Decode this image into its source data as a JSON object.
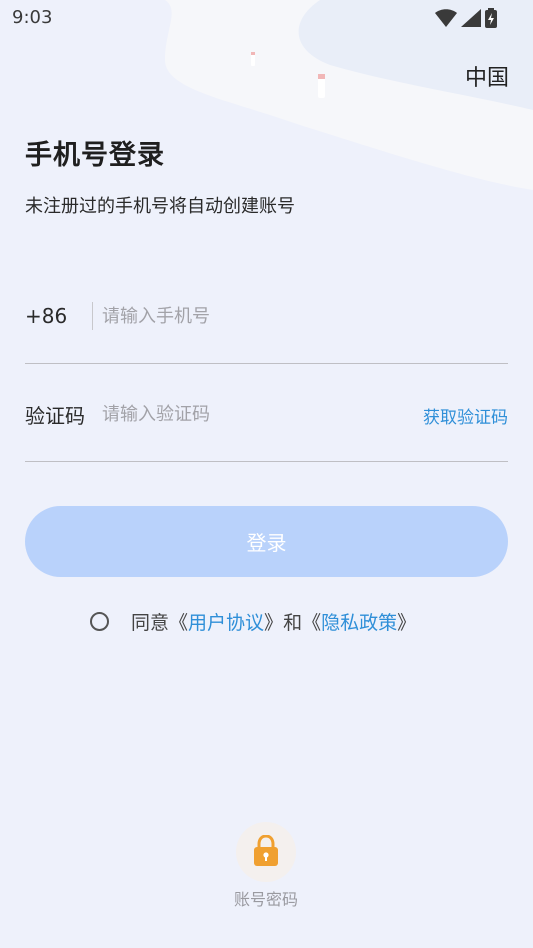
{
  "status_bar": {
    "time": "9:03"
  },
  "header": {
    "region": "中国",
    "title": "手机号登录",
    "subtitle": "未注册过的手机号将自动创建账号"
  },
  "phone": {
    "country_code": "+86",
    "placeholder": "请输入手机号",
    "value": ""
  },
  "code": {
    "label": "验证码",
    "placeholder": "请输入验证码",
    "value": "",
    "get_code_label": "获取验证码"
  },
  "login_button": {
    "label": "登录"
  },
  "agreement": {
    "prefix": "同意",
    "open_bracket": "《",
    "close_bracket": "》",
    "user_agreement": "用户协议",
    "and": "和",
    "privacy_policy": "隐私政策",
    "checked": false
  },
  "alt_login": {
    "label": "账号密码",
    "icon": "lock-icon"
  },
  "colors": {
    "accent": "#2f8fd8",
    "button_disabled": "#b9d2fb",
    "background": "#eef1fb",
    "lock": "#f0a030"
  }
}
